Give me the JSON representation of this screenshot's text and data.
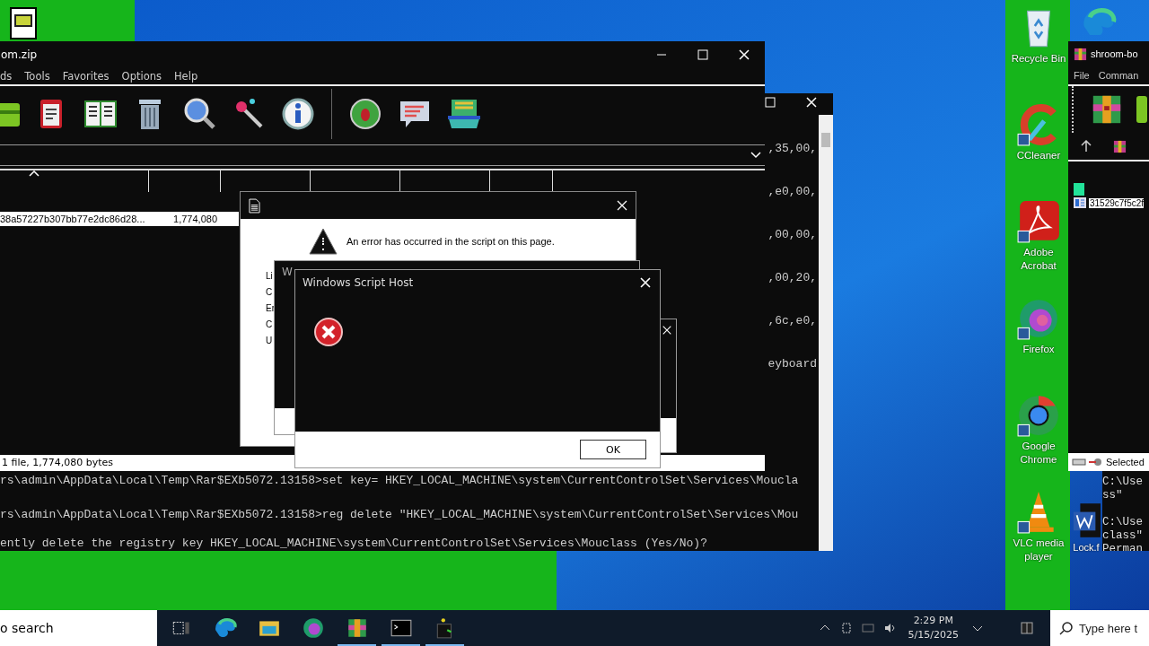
{
  "archive_window": {
    "title": "om.zip",
    "menu": [
      "ds",
      "Tools",
      "Favorites",
      "Options",
      "Help"
    ],
    "files": [
      {
        "name": "38a57227b307bb77e2dc86d28...",
        "size": "1,774,080"
      }
    ],
    "status": "1 file, 1,774,080 bytes"
  },
  "console": {
    "fragments": [
      ",35,00,",
      ",e0,00,",
      ",00,00,",
      ",00,20,",
      ",6c,e0,",
      "eyboard"
    ],
    "lines": [
      "rs\\admin\\AppData\\Local\\Temp\\Rar$EXb5072.13158>set key= HKEY_LOCAL_MACHINE\\system\\CurrentControlSet\\Services\\Moucla",
      "rs\\admin\\AppData\\Local\\Temp\\Rar$EXb5072.13158>reg delete \"HKEY_LOCAL_MACHINE\\system\\CurrentControlSet\\Services\\Mou",
      "ently delete the registry key HKEY_LOCAL_MACHINE\\system\\CurrentControlSet\\Services\\Mouclass (Yes/No)?"
    ]
  },
  "script_error_dialog": {
    "message": "An error has occurred in the script on this page.",
    "labels": [
      "Li",
      "C",
      "Er",
      "C",
      "U"
    ]
  },
  "script_host_back": {
    "title": "W"
  },
  "script_host_dialog": {
    "title": "Windows Script Host",
    "button": "OK"
  },
  "archive_window_2": {
    "title": "shroom-bo",
    "menu": [
      "File",
      "Comman"
    ],
    "files": [
      {
        "name": "31529c7f5c2f"
      }
    ],
    "status": "Selected"
  },
  "console_2": {
    "lines": [
      "C:\\Use",
      "ss\"",
      "C:\\Use",
      "class\"",
      "Perman"
    ]
  },
  "desktop_icons": [
    {
      "kind": "recycle",
      "label": "Recycle Bin"
    },
    {
      "kind": "cleaner",
      "label": "CCleaner"
    },
    {
      "kind": "pdf",
      "label": "Adobe Acrobat"
    },
    {
      "kind": "fox",
      "label": "Firefox"
    },
    {
      "kind": "chrome",
      "label": "Google Chrome"
    },
    {
      "kind": "cone",
      "label": "VLC media player"
    }
  ],
  "desktop_icons_2": [
    {
      "kind": "edge"
    },
    {
      "kind": "doc",
      "label": "Lock.f"
    }
  ],
  "taskbar": {
    "search": "o search",
    "apps": [
      {
        "kind": "taskview",
        "running": false
      },
      {
        "kind": "edge",
        "running": false
      },
      {
        "kind": "folder",
        "running": false
      },
      {
        "kind": "fox",
        "running": false
      },
      {
        "kind": "archive",
        "running": true
      },
      {
        "kind": "terminal",
        "running": true
      },
      {
        "kind": "bug",
        "running": true
      }
    ],
    "time": "2:29 PM",
    "date": "5/15/2025",
    "search_right": "Type here t"
  }
}
